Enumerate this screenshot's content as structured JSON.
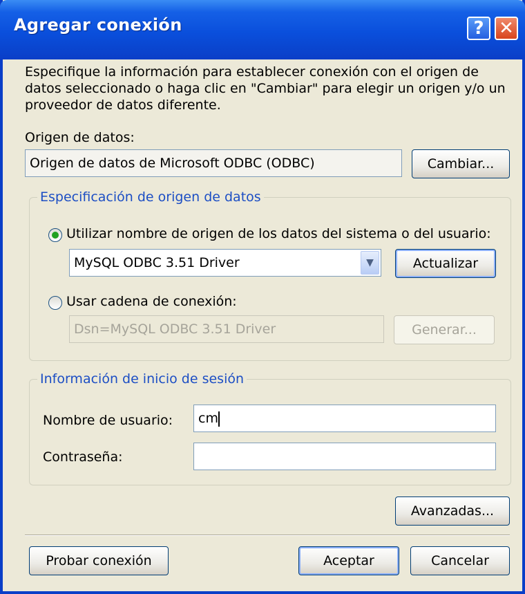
{
  "title": "Agregar conexión",
  "description": "Especifique la información para establecer conexión con el origen de datos seleccionado o haga clic en \"Cambiar\" para elegir un origen y/o un proveedor de datos diferente.",
  "data_source": {
    "label": "Origen de datos:",
    "value": "Origen de datos de Microsoft ODBC (ODBC)",
    "change_button": "Cambiar..."
  },
  "data_source_spec": {
    "group_title": "Especificación de origen de datos",
    "dsn_option": {
      "label": "Utilizar nombre de origen de los datos del sistema o del usuario:",
      "selected": true,
      "combo_value": "MySQL ODBC 3.51 Driver",
      "refresh_button": "Actualizar"
    },
    "connstr_option": {
      "label": "Usar cadena de conexión:",
      "selected": false,
      "value": "Dsn=MySQL ODBC 3.51 Driver",
      "build_button": "Generar..."
    }
  },
  "login": {
    "group_title": "Información de inicio de sesión",
    "username_label": "Nombre de usuario:",
    "username_value": "cm",
    "password_label": "Contraseña:",
    "password_value": ""
  },
  "buttons": {
    "advanced": "Avanzadas...",
    "test": "Probar conexión",
    "ok": "Aceptar",
    "cancel": "Cancelar"
  },
  "title_buttons": {
    "help": "?",
    "close": "✕"
  },
  "icons": {
    "help": "question-mark-icon",
    "close": "close-x-icon",
    "combo": "chevron-down-icon"
  },
  "colors": {
    "titlebar": "#0a46d0",
    "dialog_bg": "#ece9d8",
    "group_title": "#1c4ec4",
    "radio_dot": "#21a121"
  }
}
